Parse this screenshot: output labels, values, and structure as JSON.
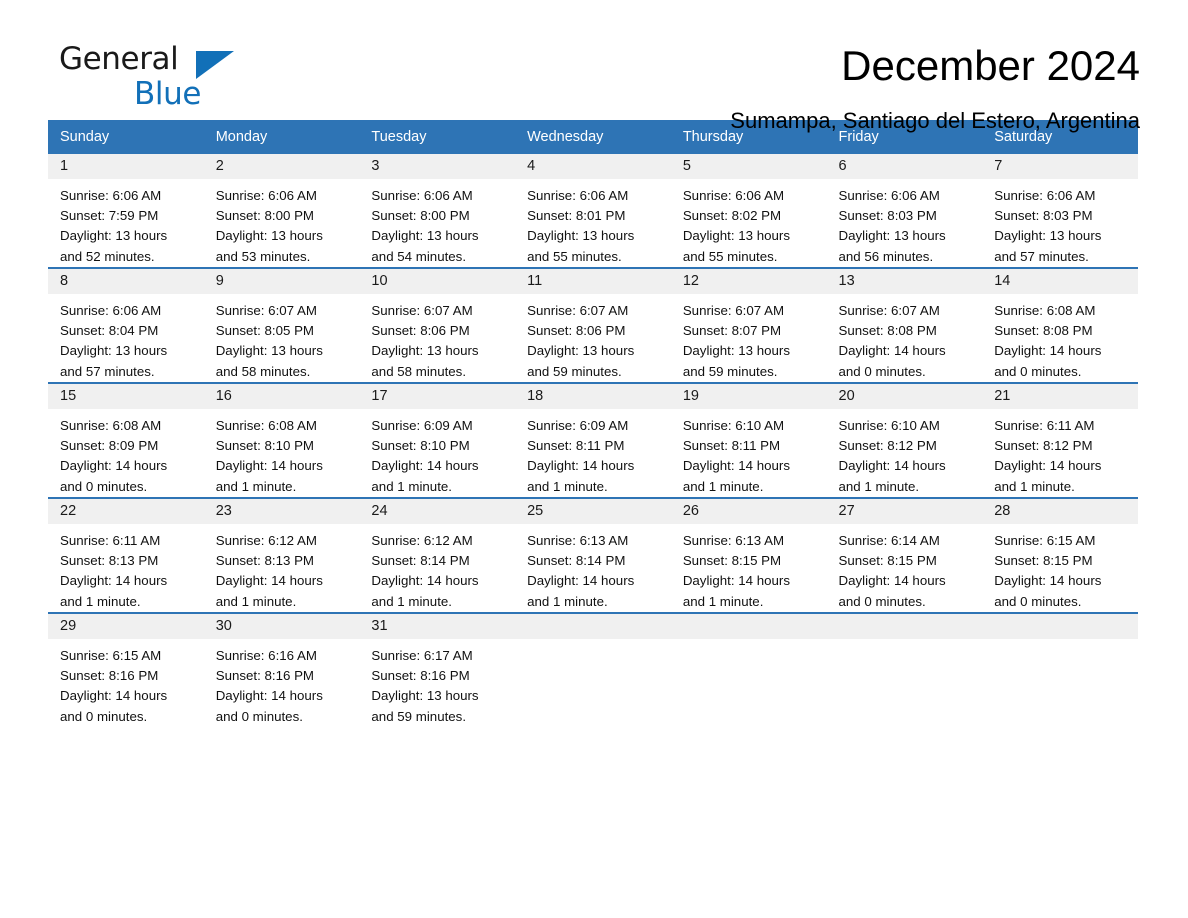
{
  "brand": {
    "name_part1": "General",
    "name_part2": "Blue",
    "accent_color": "#1270b8"
  },
  "header": {
    "title": "December 2024",
    "subtitle": "Sumampa, Santiago del Estero, Argentina"
  },
  "calendar": {
    "header_bg": "#2e74b5",
    "daynum_bg": "#f0f0f0",
    "weekday_labels": [
      "Sunday",
      "Monday",
      "Tuesday",
      "Wednesday",
      "Thursday",
      "Friday",
      "Saturday"
    ],
    "weeks": [
      [
        {
          "day": "1",
          "sunrise": "Sunrise: 6:06 AM",
          "sunset": "Sunset: 7:59 PM",
          "daylight1": "Daylight: 13 hours",
          "daylight2": "and 52 minutes."
        },
        {
          "day": "2",
          "sunrise": "Sunrise: 6:06 AM",
          "sunset": "Sunset: 8:00 PM",
          "daylight1": "Daylight: 13 hours",
          "daylight2": "and 53 minutes."
        },
        {
          "day": "3",
          "sunrise": "Sunrise: 6:06 AM",
          "sunset": "Sunset: 8:00 PM",
          "daylight1": "Daylight: 13 hours",
          "daylight2": "and 54 minutes."
        },
        {
          "day": "4",
          "sunrise": "Sunrise: 6:06 AM",
          "sunset": "Sunset: 8:01 PM",
          "daylight1": "Daylight: 13 hours",
          "daylight2": "and 55 minutes."
        },
        {
          "day": "5",
          "sunrise": "Sunrise: 6:06 AM",
          "sunset": "Sunset: 8:02 PM",
          "daylight1": "Daylight: 13 hours",
          "daylight2": "and 55 minutes."
        },
        {
          "day": "6",
          "sunrise": "Sunrise: 6:06 AM",
          "sunset": "Sunset: 8:03 PM",
          "daylight1": "Daylight: 13 hours",
          "daylight2": "and 56 minutes."
        },
        {
          "day": "7",
          "sunrise": "Sunrise: 6:06 AM",
          "sunset": "Sunset: 8:03 PM",
          "daylight1": "Daylight: 13 hours",
          "daylight2": "and 57 minutes."
        }
      ],
      [
        {
          "day": "8",
          "sunrise": "Sunrise: 6:06 AM",
          "sunset": "Sunset: 8:04 PM",
          "daylight1": "Daylight: 13 hours",
          "daylight2": "and 57 minutes."
        },
        {
          "day": "9",
          "sunrise": "Sunrise: 6:07 AM",
          "sunset": "Sunset: 8:05 PM",
          "daylight1": "Daylight: 13 hours",
          "daylight2": "and 58 minutes."
        },
        {
          "day": "10",
          "sunrise": "Sunrise: 6:07 AM",
          "sunset": "Sunset: 8:06 PM",
          "daylight1": "Daylight: 13 hours",
          "daylight2": "and 58 minutes."
        },
        {
          "day": "11",
          "sunrise": "Sunrise: 6:07 AM",
          "sunset": "Sunset: 8:06 PM",
          "daylight1": "Daylight: 13 hours",
          "daylight2": "and 59 minutes."
        },
        {
          "day": "12",
          "sunrise": "Sunrise: 6:07 AM",
          "sunset": "Sunset: 8:07 PM",
          "daylight1": "Daylight: 13 hours",
          "daylight2": "and 59 minutes."
        },
        {
          "day": "13",
          "sunrise": "Sunrise: 6:07 AM",
          "sunset": "Sunset: 8:08 PM",
          "daylight1": "Daylight: 14 hours",
          "daylight2": "and 0 minutes."
        },
        {
          "day": "14",
          "sunrise": "Sunrise: 6:08 AM",
          "sunset": "Sunset: 8:08 PM",
          "daylight1": "Daylight: 14 hours",
          "daylight2": "and 0 minutes."
        }
      ],
      [
        {
          "day": "15",
          "sunrise": "Sunrise: 6:08 AM",
          "sunset": "Sunset: 8:09 PM",
          "daylight1": "Daylight: 14 hours",
          "daylight2": "and 0 minutes."
        },
        {
          "day": "16",
          "sunrise": "Sunrise: 6:08 AM",
          "sunset": "Sunset: 8:10 PM",
          "daylight1": "Daylight: 14 hours",
          "daylight2": "and 1 minute."
        },
        {
          "day": "17",
          "sunrise": "Sunrise: 6:09 AM",
          "sunset": "Sunset: 8:10 PM",
          "daylight1": "Daylight: 14 hours",
          "daylight2": "and 1 minute."
        },
        {
          "day": "18",
          "sunrise": "Sunrise: 6:09 AM",
          "sunset": "Sunset: 8:11 PM",
          "daylight1": "Daylight: 14 hours",
          "daylight2": "and 1 minute."
        },
        {
          "day": "19",
          "sunrise": "Sunrise: 6:10 AM",
          "sunset": "Sunset: 8:11 PM",
          "daylight1": "Daylight: 14 hours",
          "daylight2": "and 1 minute."
        },
        {
          "day": "20",
          "sunrise": "Sunrise: 6:10 AM",
          "sunset": "Sunset: 8:12 PM",
          "daylight1": "Daylight: 14 hours",
          "daylight2": "and 1 minute."
        },
        {
          "day": "21",
          "sunrise": "Sunrise: 6:11 AM",
          "sunset": "Sunset: 8:12 PM",
          "daylight1": "Daylight: 14 hours",
          "daylight2": "and 1 minute."
        }
      ],
      [
        {
          "day": "22",
          "sunrise": "Sunrise: 6:11 AM",
          "sunset": "Sunset: 8:13 PM",
          "daylight1": "Daylight: 14 hours",
          "daylight2": "and 1 minute."
        },
        {
          "day": "23",
          "sunrise": "Sunrise: 6:12 AM",
          "sunset": "Sunset: 8:13 PM",
          "daylight1": "Daylight: 14 hours",
          "daylight2": "and 1 minute."
        },
        {
          "day": "24",
          "sunrise": "Sunrise: 6:12 AM",
          "sunset": "Sunset: 8:14 PM",
          "daylight1": "Daylight: 14 hours",
          "daylight2": "and 1 minute."
        },
        {
          "day": "25",
          "sunrise": "Sunrise: 6:13 AM",
          "sunset": "Sunset: 8:14 PM",
          "daylight1": "Daylight: 14 hours",
          "daylight2": "and 1 minute."
        },
        {
          "day": "26",
          "sunrise": "Sunrise: 6:13 AM",
          "sunset": "Sunset: 8:15 PM",
          "daylight1": "Daylight: 14 hours",
          "daylight2": "and 1 minute."
        },
        {
          "day": "27",
          "sunrise": "Sunrise: 6:14 AM",
          "sunset": "Sunset: 8:15 PM",
          "daylight1": "Daylight: 14 hours",
          "daylight2": "and 0 minutes."
        },
        {
          "day": "28",
          "sunrise": "Sunrise: 6:15 AM",
          "sunset": "Sunset: 8:15 PM",
          "daylight1": "Daylight: 14 hours",
          "daylight2": "and 0 minutes."
        }
      ],
      [
        {
          "day": "29",
          "sunrise": "Sunrise: 6:15 AM",
          "sunset": "Sunset: 8:16 PM",
          "daylight1": "Daylight: 14 hours",
          "daylight2": "and 0 minutes."
        },
        {
          "day": "30",
          "sunrise": "Sunrise: 6:16 AM",
          "sunset": "Sunset: 8:16 PM",
          "daylight1": "Daylight: 14 hours",
          "daylight2": "and 0 minutes."
        },
        {
          "day": "31",
          "sunrise": "Sunrise: 6:17 AM",
          "sunset": "Sunset: 8:16 PM",
          "daylight1": "Daylight: 13 hours",
          "daylight2": "and 59 minutes."
        },
        {
          "day": "",
          "sunrise": "",
          "sunset": "",
          "daylight1": "",
          "daylight2": ""
        },
        {
          "day": "",
          "sunrise": "",
          "sunset": "",
          "daylight1": "",
          "daylight2": ""
        },
        {
          "day": "",
          "sunrise": "",
          "sunset": "",
          "daylight1": "",
          "daylight2": ""
        },
        {
          "day": "",
          "sunrise": "",
          "sunset": "",
          "daylight1": "",
          "daylight2": ""
        }
      ]
    ]
  }
}
